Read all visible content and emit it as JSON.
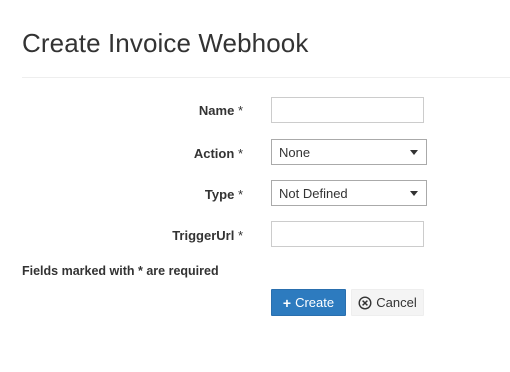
{
  "page": {
    "title": "Create Invoice Webhook"
  },
  "form": {
    "name": {
      "label": "Name",
      "required_mark": "*",
      "value": ""
    },
    "action": {
      "label": "Action",
      "required_mark": "*",
      "selected": "None"
    },
    "type": {
      "label": "Type",
      "required_mark": "*",
      "selected": "Not Defined"
    },
    "trigger_url": {
      "label": "TriggerUrl",
      "required_mark": "*",
      "value": ""
    },
    "required_note": "Fields marked with * are required"
  },
  "buttons": {
    "create_icon": "plus-icon",
    "create_label": "Create",
    "cancel_icon": "cancel-circle-icon",
    "cancel_label": "Cancel"
  },
  "colors": {
    "primary": "#2d7bbf",
    "secondary_bg": "#f4f4f4",
    "text": "#333333"
  }
}
